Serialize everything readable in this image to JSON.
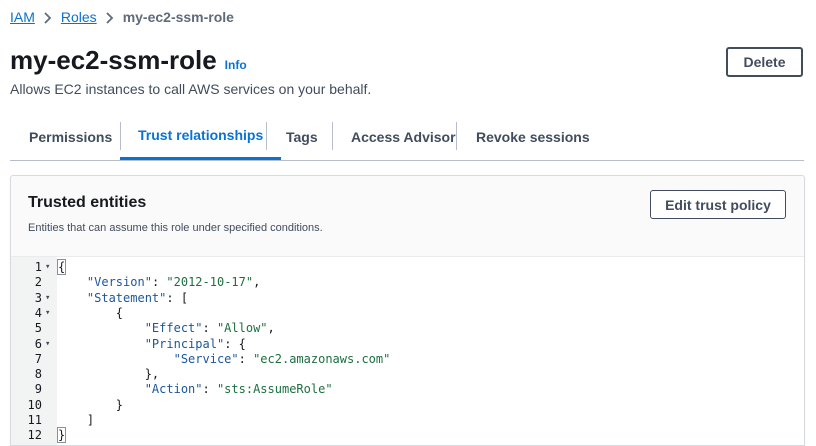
{
  "breadcrumb": {
    "items": [
      {
        "label": "IAM"
      },
      {
        "label": "Roles"
      }
    ],
    "current": "my-ec2-ssm-role"
  },
  "header": {
    "title": "my-ec2-ssm-role",
    "info_label": "Info",
    "description": "Allows EC2 instances to call AWS services on your behalf.",
    "delete_label": "Delete"
  },
  "tabs": [
    {
      "label": "Permissions",
      "active": false
    },
    {
      "label": "Trust relationships",
      "active": true
    },
    {
      "label": "Tags",
      "active": false
    },
    {
      "label": "Access Advisor",
      "active": false
    },
    {
      "label": "Revoke sessions",
      "active": false
    }
  ],
  "panel": {
    "title": "Trusted entities",
    "description": "Entities that can assume this role under specified conditions.",
    "edit_label": "Edit trust policy"
  },
  "editor": {
    "lines": [
      {
        "num": "1",
        "fold": true,
        "indent": "",
        "tokens": [
          {
            "t": "{",
            "c": "p"
          }
        ]
      },
      {
        "num": "2",
        "fold": false,
        "indent": "    ",
        "tokens": [
          {
            "t": "\"Version\"",
            "c": "k"
          },
          {
            "t": ": ",
            "c": "p"
          },
          {
            "t": "\"2012-10-17\"",
            "c": "s"
          },
          {
            "t": ",",
            "c": "p"
          }
        ]
      },
      {
        "num": "3",
        "fold": true,
        "indent": "    ",
        "tokens": [
          {
            "t": "\"Statement\"",
            "c": "k"
          },
          {
            "t": ": [",
            "c": "p"
          }
        ]
      },
      {
        "num": "4",
        "fold": true,
        "indent": "        ",
        "tokens": [
          {
            "t": "{",
            "c": "p"
          }
        ]
      },
      {
        "num": "5",
        "fold": false,
        "indent": "            ",
        "tokens": [
          {
            "t": "\"Effect\"",
            "c": "k"
          },
          {
            "t": ": ",
            "c": "p"
          },
          {
            "t": "\"Allow\"",
            "c": "s"
          },
          {
            "t": ",",
            "c": "p"
          }
        ]
      },
      {
        "num": "6",
        "fold": true,
        "indent": "            ",
        "tokens": [
          {
            "t": "\"Principal\"",
            "c": "k"
          },
          {
            "t": ": {",
            "c": "p"
          }
        ]
      },
      {
        "num": "7",
        "fold": false,
        "indent": "                ",
        "tokens": [
          {
            "t": "\"Service\"",
            "c": "k"
          },
          {
            "t": ": ",
            "c": "p"
          },
          {
            "t": "\"ec2.amazonaws.com\"",
            "c": "s"
          }
        ]
      },
      {
        "num": "8",
        "fold": false,
        "indent": "            ",
        "tokens": [
          {
            "t": "},",
            "c": "p"
          }
        ]
      },
      {
        "num": "9",
        "fold": false,
        "indent": "            ",
        "tokens": [
          {
            "t": "\"Action\"",
            "c": "k"
          },
          {
            "t": ": ",
            "c": "p"
          },
          {
            "t": "\"sts:AssumeRole\"",
            "c": "s"
          }
        ]
      },
      {
        "num": "10",
        "fold": false,
        "indent": "        ",
        "tokens": [
          {
            "t": "}",
            "c": "p"
          }
        ]
      },
      {
        "num": "11",
        "fold": false,
        "indent": "    ",
        "tokens": [
          {
            "t": "]",
            "c": "p"
          }
        ]
      },
      {
        "num": "12",
        "fold": false,
        "indent": "",
        "tokens": [
          {
            "t": "}",
            "c": "p"
          }
        ]
      }
    ]
  },
  "colors": {
    "link": "#0972d3",
    "json_key": "#1c5799",
    "json_string": "#1d6f42",
    "text": "#16191f"
  },
  "icons": {
    "breadcrumb_separator": "chevron-right-icon",
    "fold_toggle": "caret-down-icon"
  }
}
